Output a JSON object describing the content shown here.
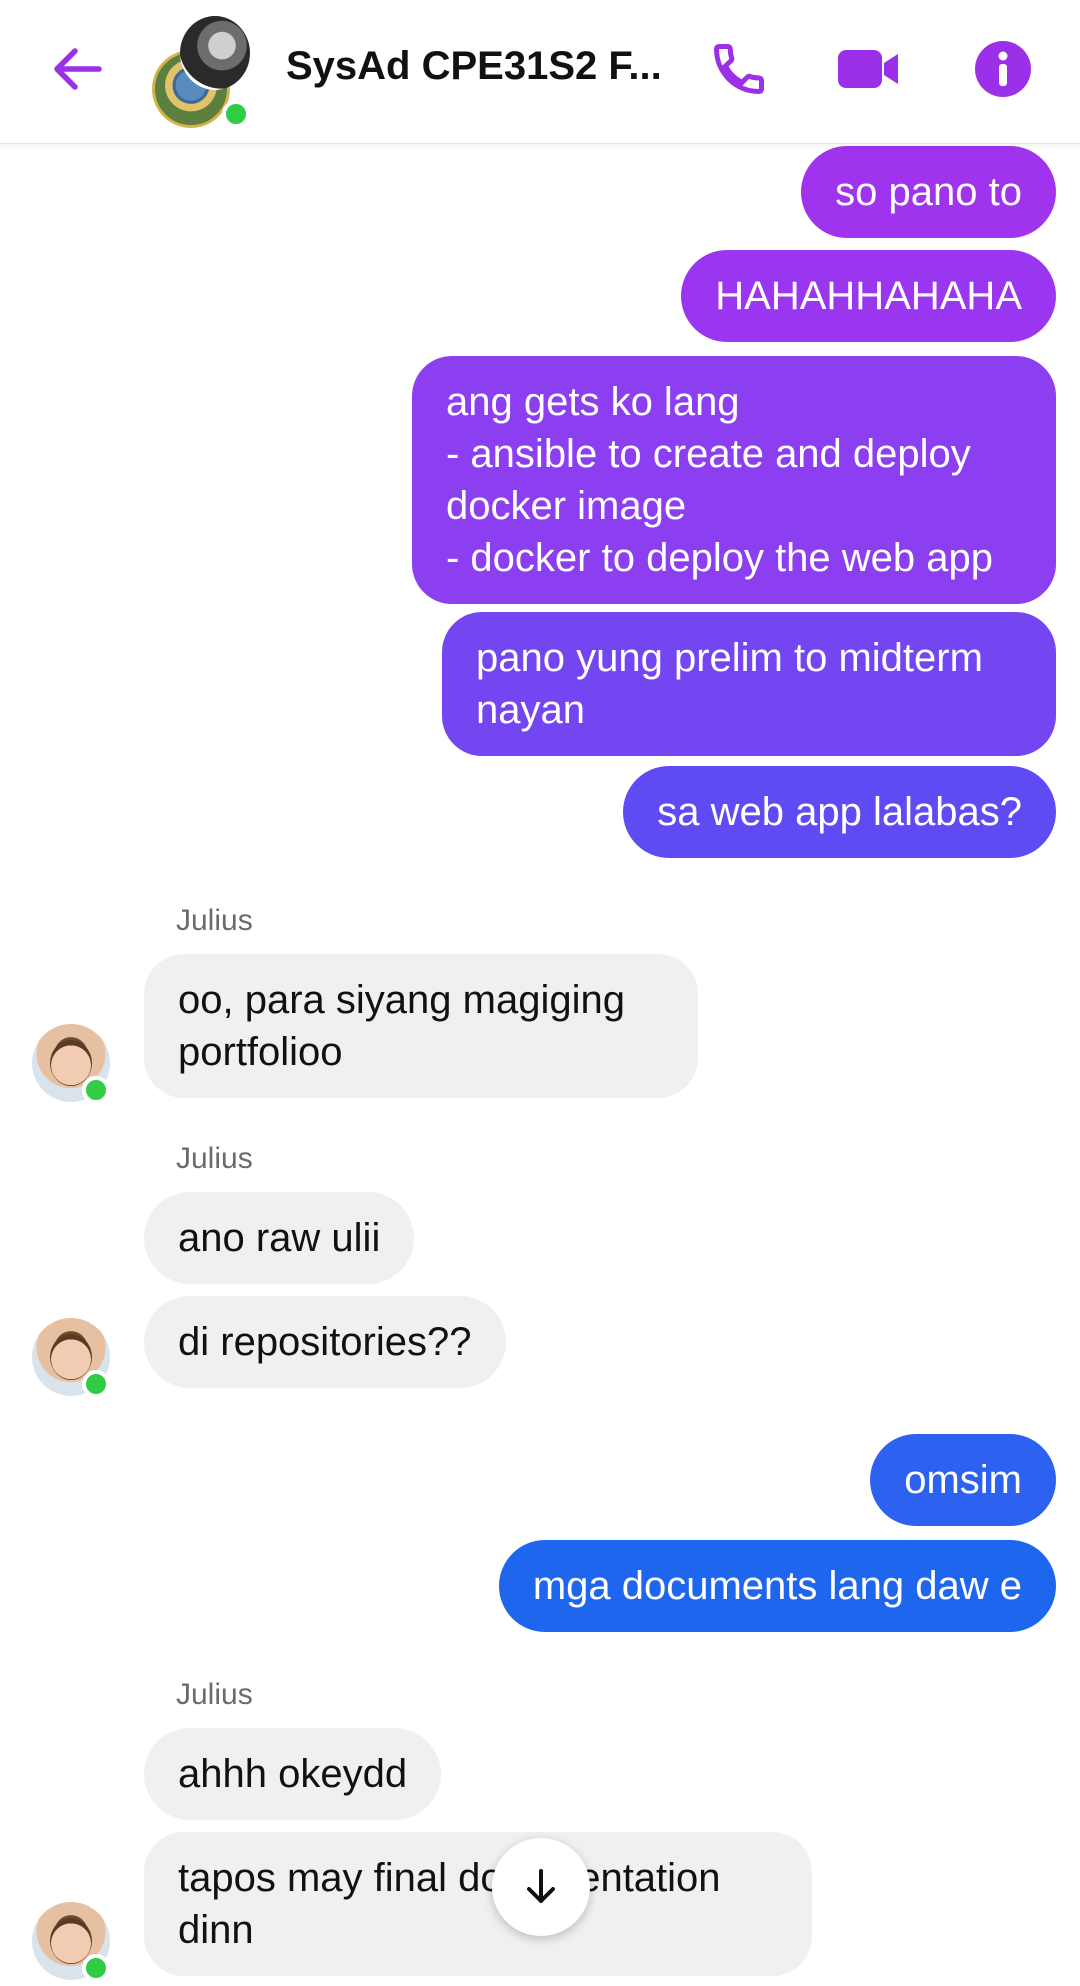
{
  "header": {
    "title": "SysAd CPE31S2 F...",
    "accent": "#9b30e8"
  },
  "messages": {
    "m1": "so pano to",
    "m2": "HAHAHHAHAHA",
    "m3": "ang gets ko lang\n- ansible to create and deploy docker image\n- docker to deploy the web app",
    "m4": "pano yung prelim to midterm nayan",
    "m5": "sa web app lalabas?",
    "s1": "Julius",
    "m6": "oo, para siyang magiging portfolioo",
    "s2": "Julius",
    "m7": "ano raw ulii",
    "m8": "di repositories??",
    "m9": "omsim",
    "m10": "mga documents lang daw e",
    "s3": "Julius",
    "m11": "ahhh okeydd",
    "m12": "tapos may final documentation dinn"
  },
  "colors": {
    "out_purple_top": "#a034ee",
    "out_purple_mid": "#7b45f2",
    "out_indigo": "#5d4cf3",
    "out_blue": "#1f66ee",
    "incoming_bg": "#f0f0f0",
    "online": "#31cc46"
  },
  "icons": {
    "back": "arrow-left-icon",
    "call": "phone-icon",
    "video": "video-camera-icon",
    "info": "info-icon",
    "scroll": "arrow-down-icon"
  }
}
